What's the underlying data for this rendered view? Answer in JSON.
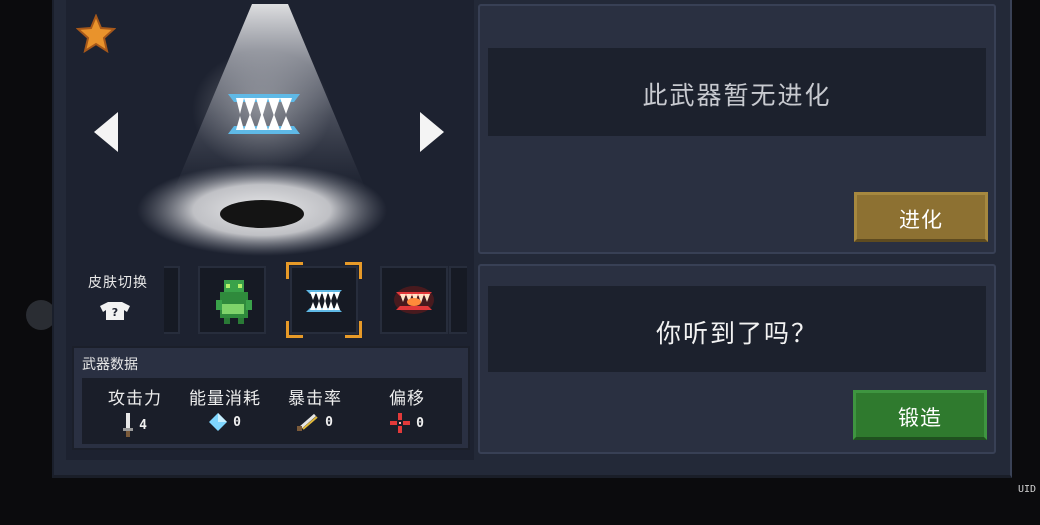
{
  "showcase": {
    "favorite_icon": "star-icon",
    "prev_icon": "arrow-left-icon",
    "next_icon": "arrow-right-icon",
    "weapon_icon": "fang-jaw-icon"
  },
  "skin": {
    "label": "皮肤切换",
    "icon": "shirt-icon",
    "skins": [
      {
        "icon": "green-monster-icon",
        "selected": false
      },
      {
        "icon": "blue-fang-jaw-icon",
        "selected": true
      },
      {
        "icon": "red-fang-jaw-icon",
        "selected": false
      }
    ]
  },
  "weapon_stats": {
    "title": "武器数据",
    "items": [
      {
        "label": "攻击力",
        "value": "4",
        "icon": "sword-icon"
      },
      {
        "label": "能量消耗",
        "value": "0",
        "icon": "diamond-icon"
      },
      {
        "label": "暴击率",
        "value": "0",
        "icon": "crit-blade-icon"
      },
      {
        "label": "偏移",
        "value": "0",
        "icon": "crosshair-icon"
      }
    ]
  },
  "evolution": {
    "message": "此武器暂无进化",
    "button_label": "进化",
    "button_color": "#8d7132"
  },
  "forge": {
    "message": "你听到了吗？",
    "button_label": "锻造",
    "button_color": "#2f7a2e"
  },
  "uid_label": "UID"
}
